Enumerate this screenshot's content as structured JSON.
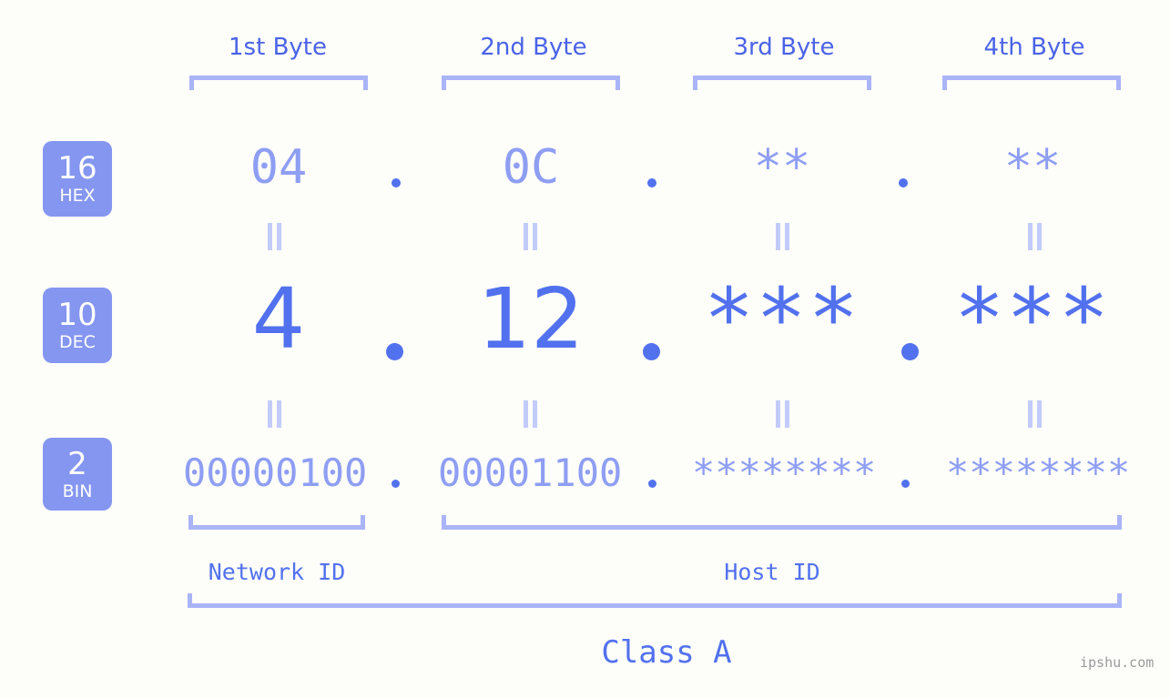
{
  "meta": {
    "background_color": "#fdfdfa",
    "accent_strong": "#5271ee",
    "accent_light": "#8e9ef3",
    "bracket_color": "#aab4f8",
    "badge_color": "#8496f0"
  },
  "headers": {
    "bytes": [
      {
        "label": "1st Byte"
      },
      {
        "label": "2nd Byte"
      },
      {
        "label": "3rd Byte"
      },
      {
        "label": "4th Byte"
      }
    ]
  },
  "rows": [
    {
      "id": "hex",
      "badge_number": "16",
      "badge_name": "HEX",
      "values": [
        "04",
        "0C",
        "**",
        "**"
      ],
      "separator": "."
    },
    {
      "id": "dec",
      "badge_number": "10",
      "badge_name": "DEC",
      "values": [
        "4",
        "12",
        "***",
        "***"
      ],
      "separator": "."
    },
    {
      "id": "bin",
      "badge_number": "2",
      "badge_name": "BIN",
      "values": [
        "00000100",
        "00001100",
        "********",
        "********"
      ],
      "separator": "."
    }
  ],
  "equals_symbol": "=",
  "footer": {
    "network_id_label": "Network ID",
    "host_id_label": "Host ID",
    "class_label": "Class A"
  },
  "watermark": "ipshu.com"
}
